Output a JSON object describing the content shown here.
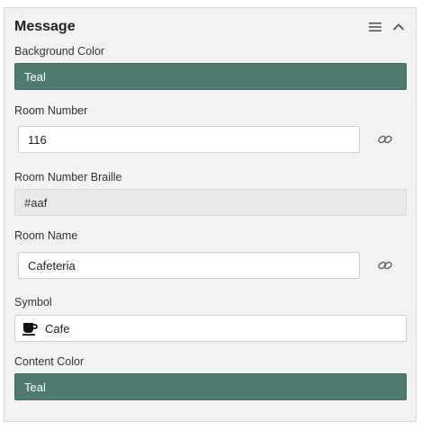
{
  "panel": {
    "title": "Message",
    "icons": {
      "menu": "menu-icon",
      "collapse": "chevron-up-icon"
    }
  },
  "fields": {
    "background_color": {
      "label": "Background Color",
      "value": "Teal",
      "color": "#4e7a72"
    },
    "room_number": {
      "label": "Room Number",
      "value": "116",
      "link_icon": "link-icon"
    },
    "room_number_braille": {
      "label": "Room Number Braille",
      "value": "#aaf"
    },
    "room_name": {
      "label": "Room Name",
      "value": "Cafeteria",
      "link_icon": "link-icon"
    },
    "symbol": {
      "label": "Symbol",
      "value": "Cafe",
      "icon": "coffee-cup-icon"
    },
    "content_color": {
      "label": "Content Color",
      "value": "Teal",
      "color": "#4e7a72"
    }
  }
}
